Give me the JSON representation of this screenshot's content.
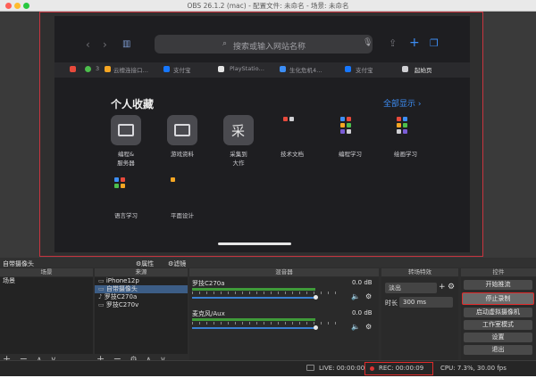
{
  "window": {
    "title": "OBS 26.1.2 (mac) - 配置文件: 未命名 - 场景: 未命名"
  },
  "preview": {
    "search_placeholder": "搜索或输入网站名称",
    "tabs": [
      {
        "label": "云檀连接口…",
        "color": "#f5a623"
      },
      {
        "label": "支付宝",
        "color": "#1677ff"
      },
      {
        "label": "PlayStatio…",
        "color": "#ffffff"
      },
      {
        "label": "生化危机4…",
        "color": "#3d8ef5"
      },
      {
        "label": "支付宝",
        "color": "#1677ff"
      },
      {
        "label": "起始页",
        "color": "#9a9aa0"
      }
    ],
    "tab_counter": "3",
    "favorites_heading": "个人收藏",
    "show_all": "全部显示 ›",
    "favorites": [
      {
        "label": "编程&\n服务器",
        "glyph": "folder"
      },
      {
        "label": "游戏资料",
        "glyph": "folder"
      },
      {
        "label": "采集到\n大作",
        "glyph": "采"
      },
      {
        "label": "技术文档",
        "glyph": "mini"
      },
      {
        "label": "编程学习",
        "glyph": "mini"
      },
      {
        "label": "绘画学习",
        "glyph": "mini"
      },
      {
        "label": "语言学习",
        "glyph": "mini"
      },
      {
        "label": "平面设计",
        "glyph": "mini"
      }
    ]
  },
  "docks": {
    "source_header": "自带摄像头",
    "properties_label": "⚙属性",
    "filters_label": "⚙滤镜",
    "scenes": {
      "title": "场景",
      "items": [
        "场景"
      ]
    },
    "sources": {
      "title": "来源",
      "items": [
        "iPhone12p",
        "自带摄像头",
        "罗技C270a",
        "罗技C270v"
      ]
    },
    "mixer": {
      "title": "混音器",
      "channels": [
        {
          "name": "罗技C270a",
          "db": "0.0 dB",
          "level": 0.82
        },
        {
          "name": "麦克风/Aux",
          "db": "0.0 dB",
          "level": 0.82
        }
      ]
    },
    "transitions": {
      "title": "转场特效",
      "type": "淡出",
      "duration_label": "时长",
      "duration_value": "300 ms"
    },
    "controls": {
      "title": "控件",
      "buttons": [
        "开始推流",
        "停止录制",
        "启动虚拟摄像机",
        "工作室模式",
        "设置",
        "退出"
      ]
    }
  },
  "status": {
    "live": "LIVE: 00:00:00",
    "rec": "REC: 00:00:09",
    "cpu": "CPU: 7.3%, 30.00 fps"
  },
  "colors": {
    "accent_blue": "#3d8ef5",
    "highlight_red": "#e02a2a",
    "meter_green": "#3f9b39"
  }
}
